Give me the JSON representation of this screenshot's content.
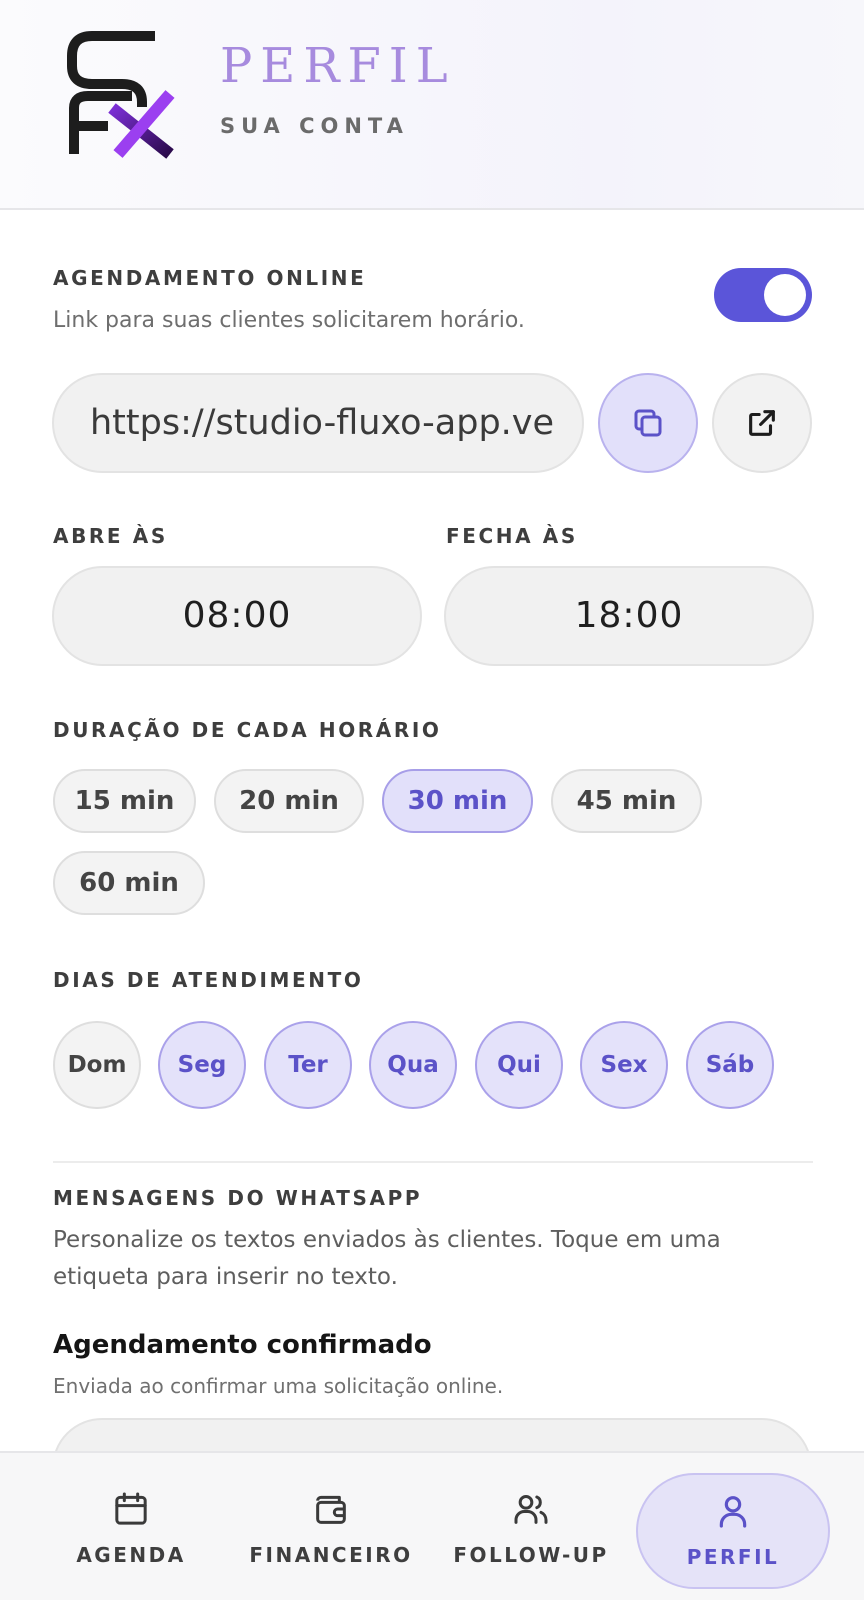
{
  "header": {
    "title": "PERFIL",
    "subtitle": "SUA CONTA",
    "logo_text": "SFX"
  },
  "online_booking": {
    "label": "AGENDAMENTO ONLINE",
    "description": "Link para suas clientes solicitarem horário.",
    "enabled": true,
    "url": "https://studio-fluxo-app.ve"
  },
  "hours": {
    "open_label": "ABRE ÀS",
    "open_value": "08:00",
    "close_label": "FECHA ÀS",
    "close_value": "18:00"
  },
  "duration": {
    "label": "DURAÇÃO DE CADA HORÁRIO",
    "options": [
      "15 min",
      "20 min",
      "30 min",
      "45 min",
      "60 min"
    ],
    "selected": "30 min"
  },
  "days": {
    "label": "DIAS DE ATENDIMENTO",
    "items": [
      "Dom",
      "Seg",
      "Ter",
      "Qua",
      "Qui",
      "Sex",
      "Sáb"
    ],
    "active": [
      false,
      true,
      true,
      true,
      true,
      true,
      true
    ]
  },
  "whatsapp": {
    "label": "MENSAGENS DO WHATSAPP",
    "description_line1": "Personalize os textos enviados às clientes. Toque em uma",
    "description_line2": "etiqueta para inserir no texto.",
    "card_title": "Agendamento confirmado",
    "card_subtitle": "Enviada ao confirmar uma solicitação online."
  },
  "nav": {
    "items": [
      {
        "label": "AGENDA",
        "icon": "calendar-icon"
      },
      {
        "label": "FINANCEIRO",
        "icon": "wallet-icon"
      },
      {
        "label": "FOLLOW-UP",
        "icon": "users-icon"
      },
      {
        "label": "PERFIL",
        "icon": "user-icon"
      }
    ],
    "active": "PERFIL"
  },
  "colors": {
    "accent": "#5b55d9",
    "accent_light": "#e2e0fa",
    "title_purple": "#a78bde"
  }
}
